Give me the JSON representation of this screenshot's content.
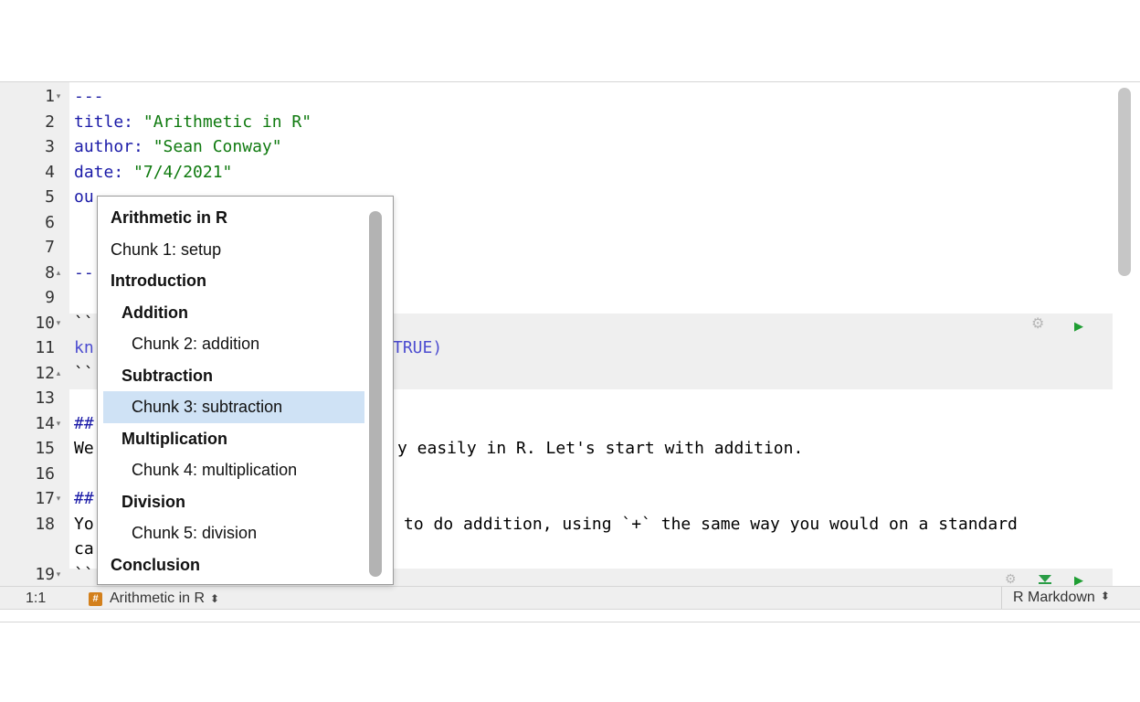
{
  "editor": {
    "line_numbers": [
      "1",
      "2",
      "3",
      "4",
      "5",
      "6",
      "7",
      "8",
      "9",
      "10",
      "11",
      "12",
      "13",
      "14",
      "15",
      "16",
      "17",
      "18",
      "",
      "19"
    ],
    "lines": {
      "l1": "---",
      "l2_key": "title:",
      "l2_val": " \"Arithmetic in R\"",
      "l3_key": "author:",
      "l3_val": " \"Sean Conway\"",
      "l4_key": "date:",
      "l4_val": " \"7/4/2021\"",
      "l5": "ou",
      "l8": "--",
      "l10": "``",
      "l11_a": "kn",
      "l11_b": "TRUE)",
      "l12": "``",
      "l14": "##",
      "l15_a": "We",
      "l15_b": "y easily in R. Let's start with addition.",
      "l17": "##",
      "l18_a": "Yo",
      "l18_b": "to do addition, using `+` the same way you would on a standard",
      "l18_wrap": "ca",
      "l19": "``"
    }
  },
  "status_bar": {
    "cursor_position": "1:1",
    "outline_badge": "#",
    "current_section": "Arithmetic in R",
    "updown_glyph": "⬍",
    "document_type": "R Markdown"
  },
  "outline_popup": {
    "items": [
      {
        "label": "Arithmetic in R",
        "level": 0,
        "bold": true,
        "selected": false
      },
      {
        "label": "Chunk 1: setup",
        "level": 0,
        "bold": false,
        "selected": false
      },
      {
        "label": "Introduction",
        "level": 0,
        "bold": true,
        "selected": false
      },
      {
        "label": "Addition",
        "level": 1,
        "bold": true,
        "selected": false
      },
      {
        "label": "Chunk 2: addition",
        "level": 2,
        "bold": false,
        "selected": false
      },
      {
        "label": "Subtraction",
        "level": 1,
        "bold": true,
        "selected": false
      },
      {
        "label": "Chunk 3: subtraction",
        "level": 2,
        "bold": false,
        "selected": true
      },
      {
        "label": "Multiplication",
        "level": 1,
        "bold": true,
        "selected": false
      },
      {
        "label": "Chunk 4: multiplication",
        "level": 2,
        "bold": false,
        "selected": false
      },
      {
        "label": "Division",
        "level": 1,
        "bold": true,
        "selected": false
      },
      {
        "label": "Chunk 5: division",
        "level": 2,
        "bold": false,
        "selected": false
      },
      {
        "label": "Conclusion",
        "level": 0,
        "bold": true,
        "selected": false
      }
    ]
  },
  "icons": {
    "fold_open": "▾",
    "fold_close": "▴",
    "gear": "⚙",
    "run": "▶",
    "run_above": "⏬"
  },
  "colors": {
    "yaml_key": "#1b1ba8",
    "yaml_string": "#0f7a0f",
    "selection": "#cfe2f5",
    "run_green": "#1f9e33",
    "outline_badge": "#d3801c"
  }
}
